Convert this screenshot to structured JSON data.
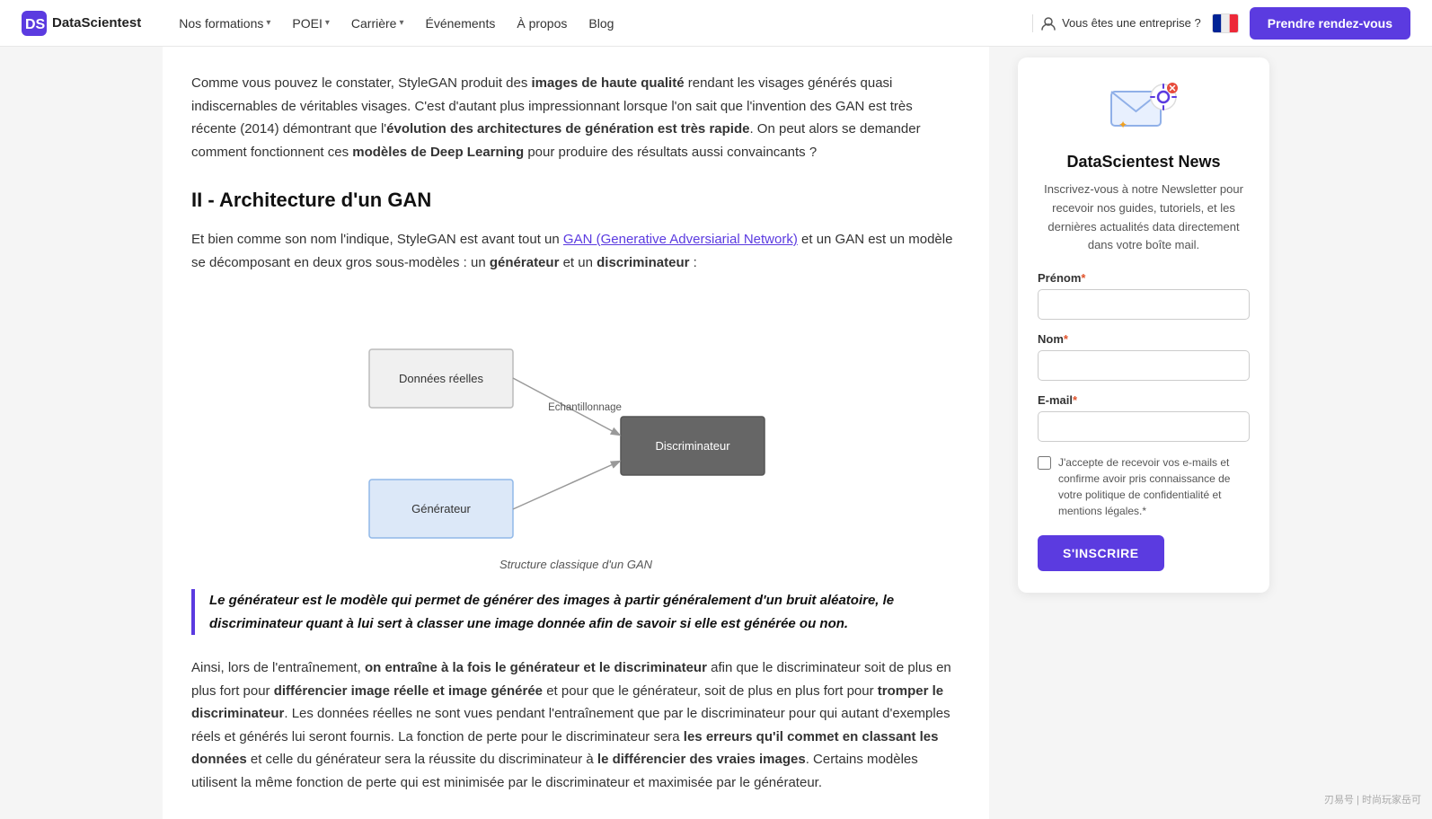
{
  "nav": {
    "logo_text": "DataScientest",
    "links": [
      {
        "label": "Nos formations",
        "has_dropdown": true
      },
      {
        "label": "POEI",
        "has_dropdown": true
      },
      {
        "label": "Carrière",
        "has_dropdown": true
      },
      {
        "label": "Événements",
        "has_dropdown": false
      },
      {
        "label": "À propos",
        "has_dropdown": false
      },
      {
        "label": "Blog",
        "has_dropdown": false
      }
    ],
    "enterprise_label": "Vous êtes une entreprise ?",
    "cta_label": "Prendre rendez-vous"
  },
  "main": {
    "intro": {
      "text_before_bold1": "Comme vous pouvez le constater, StyleGAN produit des ",
      "bold1": "images de haute qualité",
      "text_after_bold1": " rendant les visages générés quasi indiscernables de véritables visages. C'est d'autant plus impressionnant lorsque l'on sait que l'invention des GAN est très récente (2014) démontrant que l'",
      "bold2": "évolution des architectures de génération est très rapide",
      "text_after_bold2": ". On peut alors se demander comment fonctionnent ces ",
      "bold3": "modèles de Deep Learning",
      "text_end": " pour produire des résultats aussi convaincants ?"
    },
    "section_title": "II - Architecture d'un GAN",
    "section_para1_start": "Et bien comme son nom l'indique, StyleGAN est avant tout un ",
    "section_para1_link": "GAN (Generative Adversiarial Network)",
    "section_para1_end": " et un GAN est un modèle se décomposant en deux gros sous-modèles : un ",
    "section_para1_bold1": "générateur",
    "section_para1_mid": " et un ",
    "section_para1_bold2": "discriminateur",
    "section_para1_last": " :",
    "diagram": {
      "caption": "Structure classique d'un GAN",
      "node_reelles": "Données réelles",
      "node_echantillonnage": "Echantillonnage",
      "node_discriminateur": "Discriminateur",
      "node_generateur": "Générateur"
    },
    "blockquote": "Le générateur est le modèle qui permet de générer des images à partir généralement d'un bruit aléatoire, le discriminateur quant à lui sert à classer une image donnée afin de savoir si elle est générée ou non.",
    "bottom_para_start": "Ainsi, lors de l'entraînement, ",
    "bottom_bold1": "on entraîne à la fois le générateur et le discriminateur",
    "bottom_text1": " afin que le discriminateur soit de plus en plus fort pour ",
    "bottom_bold2": "différencier image réelle et image générée",
    "bottom_text2": " et pour que le générateur, soit de plus en plus fort pour ",
    "bottom_bold3": "tromper le discriminateur",
    "bottom_text3": ". Les données réelles ne sont vues pendant l'entraînement que par le discriminateur pour qui autant d'exemples réels et générés lui seront fournis. La fonction de perte pour le discriminateur sera ",
    "bottom_bold4": "les erreurs qu'il commet en classant les données",
    "bottom_text4": " et celle du générateur sera la réussite du discriminateur à ",
    "bottom_bold5": "le différencier des vraies images",
    "bottom_text5": ". Certains modèles utilisent la même fonction de perte qui est minimisée par le discriminateur et maximisée par le générateur."
  },
  "sidebar": {
    "title": "DataScientest News",
    "description": "Inscrivez-vous à notre Newsletter pour recevoir nos guides, tutoriels, et les dernières actualités data directement dans votre boîte mail.",
    "prenom_label": "Prénom",
    "prenom_req": "*",
    "nom_label": "Nom",
    "nom_req": "*",
    "email_label": "E-mail",
    "email_req": "*",
    "checkbox_text": "J'accepte de recevoir vos e-mails et confirme avoir pris connaissance de votre politique de confidentialité et mentions légales.",
    "checkbox_req": "*",
    "submit_label": "S'INSCRIRE"
  },
  "watermark": "刃易号 | 时尚玩家岳可"
}
